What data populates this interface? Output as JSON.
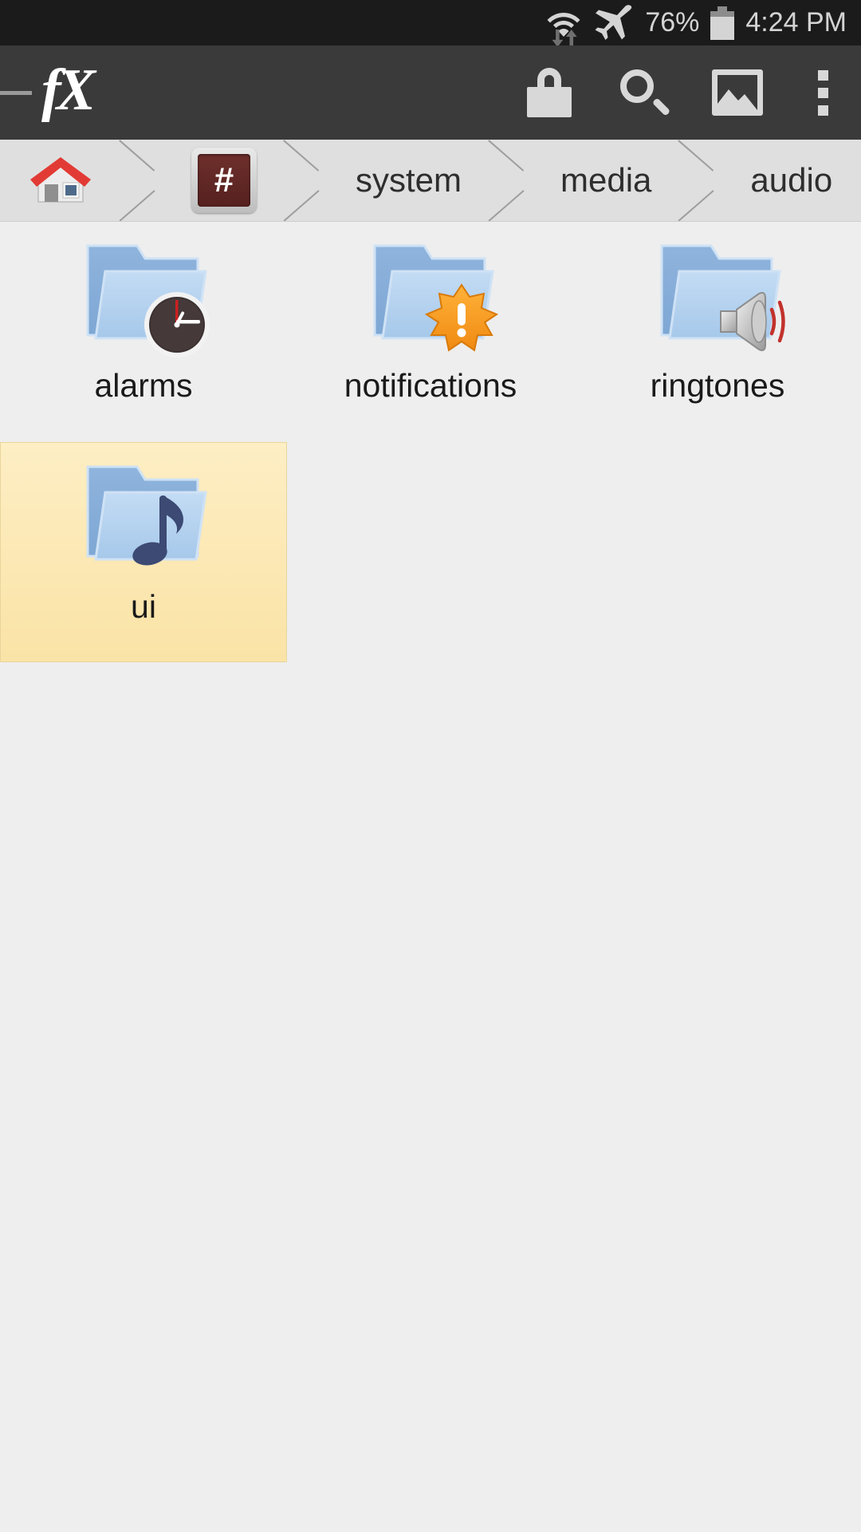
{
  "status_bar": {
    "icons": [
      "wifi-icon",
      "data-transfer-icon",
      "airplane-mode-icon"
    ],
    "battery_percent": "76%",
    "time": "4:24 PM",
    "background_color": "#1b1b1b",
    "text_color": "#d4d4d4"
  },
  "app_bar": {
    "app_name": "FX",
    "logo_text": "fX",
    "background_color": "#3a3a3a",
    "actions": [
      {
        "name": "lock-icon",
        "label": "Lock"
      },
      {
        "name": "search-icon",
        "label": "Search"
      },
      {
        "name": "image-icon",
        "label": "Images"
      },
      {
        "name": "overflow-menu-icon",
        "label": "More options"
      }
    ]
  },
  "breadcrumb": {
    "background_color": "#dfdfdf",
    "items": [
      {
        "label": "",
        "icon": "home-icon",
        "type": "icon"
      },
      {
        "label": "#",
        "icon": "root-hash-icon",
        "type": "icon"
      },
      {
        "label": "system",
        "type": "text"
      },
      {
        "label": "media",
        "type": "text"
      },
      {
        "label": "audio",
        "type": "text"
      }
    ]
  },
  "file_grid": {
    "selection_color": "#fbe5ab",
    "items": [
      {
        "label": "alarms",
        "icon": "folder-clock-icon",
        "selected": false
      },
      {
        "label": "notifications",
        "icon": "folder-alert-icon",
        "selected": false
      },
      {
        "label": "ringtones",
        "icon": "folder-speaker-icon",
        "selected": false
      },
      {
        "label": "ui",
        "icon": "folder-music-icon",
        "selected": true
      }
    ]
  }
}
